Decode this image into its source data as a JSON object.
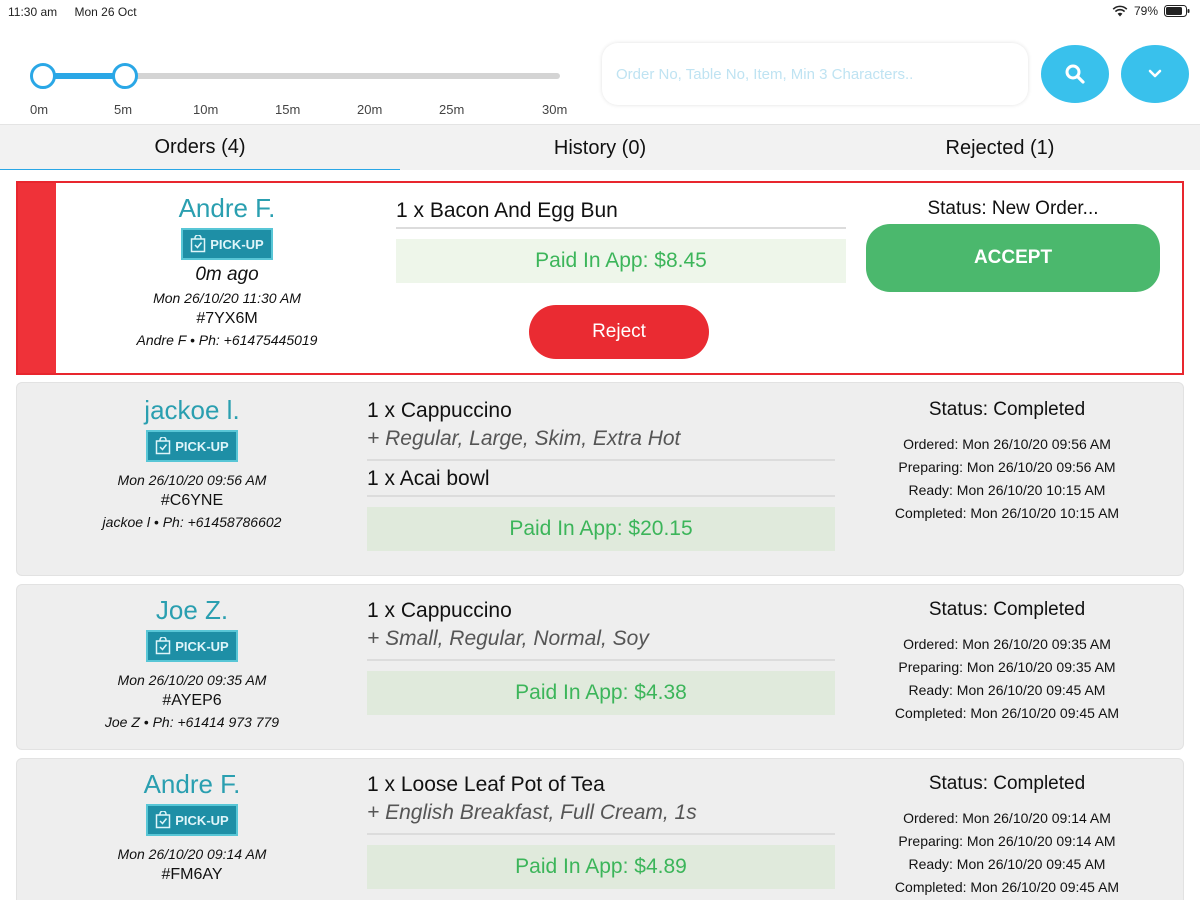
{
  "status_bar": {
    "time": "11:30 am",
    "date": "Mon 26 Oct",
    "battery": "79%"
  },
  "slider": {
    "ticks": [
      "0m",
      "5m",
      "10m",
      "15m",
      "20m",
      "25m",
      "30m"
    ],
    "selected_min": "0m",
    "selected_max": "5m",
    "accent": "#2aa7e6"
  },
  "search": {
    "placeholder": "Order No, Table No, Item, Min 3 Characters.."
  },
  "tabs": [
    {
      "label": "Orders (4)"
    },
    {
      "label": "History (0)"
    },
    {
      "label": "Rejected (1)"
    }
  ],
  "orders": [
    {
      "name": "Andre F.",
      "badge": "PICK-UP",
      "ago": "0m ago",
      "date": "Mon 26/10/20 11:30 AM",
      "code": "#7YX6M",
      "contact": "Andre F • Ph: +61475445019",
      "items": [
        {
          "line": "1 x Bacon And Egg Bun",
          "options": ""
        }
      ],
      "paid": "Paid In App: $8.45",
      "status": "Status: New Order...",
      "accept_label": "ACCEPT",
      "reject_label": "Reject"
    },
    {
      "name": "jackoe l.",
      "badge": "PICK-UP",
      "date": "Mon 26/10/20 09:56 AM",
      "code": "#C6YNE",
      "contact": "jackoe l • Ph: +61458786602",
      "items": [
        {
          "line": "1 x Cappuccino",
          "options": "+ Regular, Large, Skim, Extra Hot"
        },
        {
          "line": "1 x Acai bowl",
          "options": ""
        }
      ],
      "paid": "Paid In App: $20.15",
      "status": "Status: Completed",
      "timeline": [
        "Ordered: Mon 26/10/20 09:56 AM",
        "Preparing: Mon 26/10/20 09:56 AM",
        "Ready: Mon 26/10/20 10:15 AM",
        "Completed: Mon 26/10/20 10:15 AM"
      ]
    },
    {
      "name": "Joe Z.",
      "badge": "PICK-UP",
      "date": "Mon 26/10/20 09:35 AM",
      "code": "#AYEP6",
      "contact": "Joe Z • Ph: +61414 973 779",
      "items": [
        {
          "line": "1 x Cappuccino",
          "options": "+ Small, Regular, Normal, Soy"
        }
      ],
      "paid": "Paid In App: $4.38",
      "status": "Status: Completed",
      "timeline": [
        "Ordered: Mon 26/10/20 09:35 AM",
        "Preparing: Mon 26/10/20 09:35 AM",
        "Ready: Mon 26/10/20 09:45 AM",
        "Completed: Mon 26/10/20 09:45 AM"
      ]
    },
    {
      "name": "Andre F.",
      "badge": "PICK-UP",
      "date": "Mon 26/10/20 09:14 AM",
      "code": "#FM6AY",
      "contact": "",
      "items": [
        {
          "line": "1 x Loose Leaf Pot of Tea",
          "options": "+ English Breakfast, Full Cream, 1s"
        }
      ],
      "paid": "Paid In App: $4.89",
      "status": "Status: Completed",
      "timeline": [
        "Ordered: Mon 26/10/20 09:14 AM",
        "Preparing: Mon 26/10/20 09:14 AM",
        "Ready: Mon 26/10/20 09:45 AM",
        "Completed: Mon 26/10/20 09:45 AM"
      ]
    }
  ],
  "colors": {
    "accent": "#39c1ec",
    "accept": "#4bb86d",
    "reject": "#ea2b32",
    "paid_text": "#3cb55a",
    "customer_name": "#2a9fb0"
  }
}
